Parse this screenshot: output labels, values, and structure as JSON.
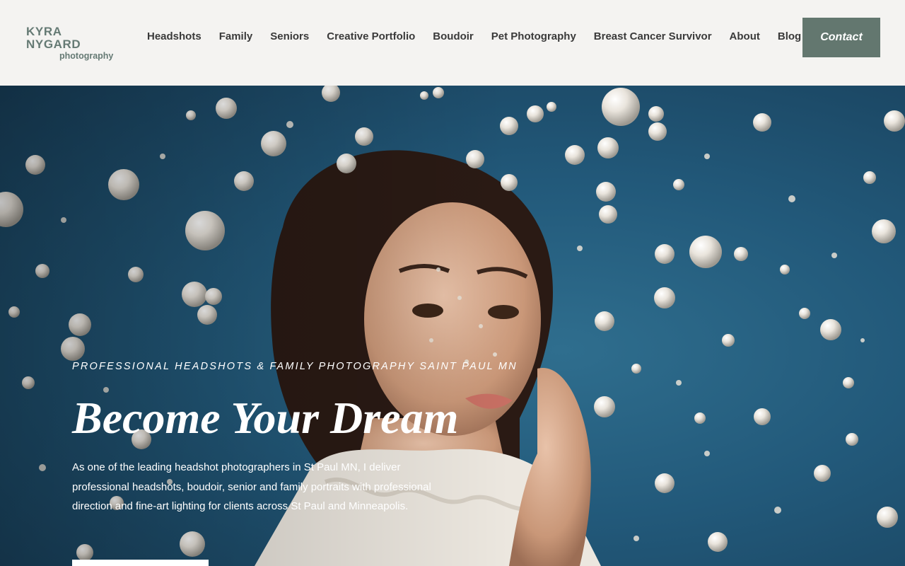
{
  "brand": {
    "line1": "KYRA NYGARD",
    "line2": "photography"
  },
  "nav": {
    "items": [
      {
        "label": "Headshots"
      },
      {
        "label": "Family"
      },
      {
        "label": "Seniors"
      },
      {
        "label": "Creative Portfolio"
      },
      {
        "label": "Boudoir"
      },
      {
        "label": "Pet Photography"
      },
      {
        "label": "Breast Cancer Survivor"
      },
      {
        "label": "About"
      },
      {
        "label": "Blog"
      }
    ],
    "contact_label": "Contact"
  },
  "hero": {
    "eyebrow": "PROFESSIONAL HEADSHOTS & FAMILY PHOTOGRAPHY SAINT PAUL MN",
    "headline": "Become Your Dream",
    "description": "As one of the leading headshot photographers in St Paul MN, I deliver professional headshots, boudoir, senior and family portraits with professional direction and fine-art lighting for clients across St Paul and Minneapolis."
  },
  "colors": {
    "accent": "#63776f",
    "logo": "#657a74",
    "hero_bg": "#22597a",
    "nav_text": "#3a3a3a"
  }
}
